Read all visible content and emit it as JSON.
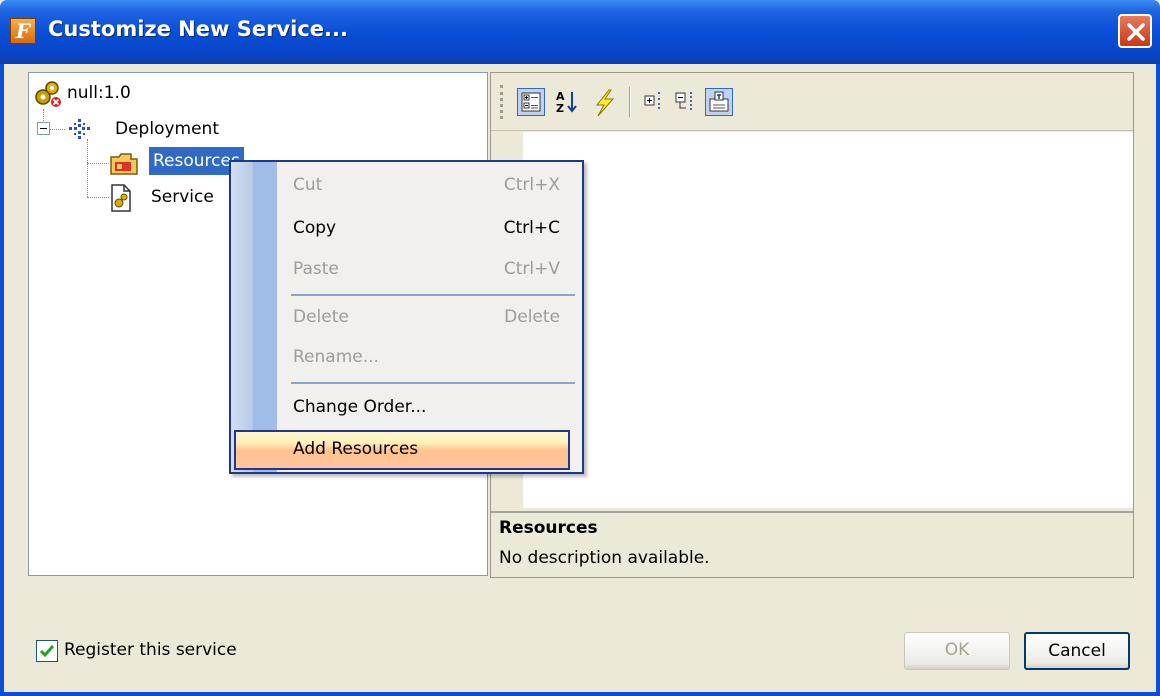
{
  "window": {
    "title": "Customize New Service...",
    "app_icon_letter": "F",
    "icons": {
      "app": "app-logo-icon",
      "close": "close-icon"
    }
  },
  "tree": {
    "root": {
      "label": "null:1.0",
      "icon": "service-gears-error-icon"
    },
    "nodes": [
      {
        "label": "Deployment",
        "icon": "deployment-icon",
        "expanded": true
      },
      {
        "label": "Resources",
        "icon": "folder-icon",
        "selected": true
      },
      {
        "label": "Service ",
        "icon": "service-document-icon"
      }
    ]
  },
  "toolbar": {
    "buttons": [
      {
        "name": "categorized-view",
        "icon": "categorized-icon",
        "pressed": true
      },
      {
        "name": "sort-alphabetical",
        "icon": "sort-az-icon",
        "pressed": false
      },
      {
        "name": "events",
        "icon": "lightning-icon",
        "pressed": false
      },
      {
        "name": "expand-all",
        "icon": "expand-all-icon",
        "pressed": false
      },
      {
        "name": "collapse-all",
        "icon": "collapse-all-icon",
        "pressed": false
      },
      {
        "name": "show-description",
        "icon": "description-icon",
        "pressed": true
      }
    ]
  },
  "description": {
    "title": "Resources",
    "text": "No description available."
  },
  "context_menu": {
    "items": [
      {
        "label": "Cut",
        "shortcut": "Ctrl+X",
        "enabled": false
      },
      {
        "label": "Copy",
        "shortcut": "Ctrl+C",
        "enabled": true
      },
      {
        "label": "Paste",
        "shortcut": "Ctrl+V",
        "enabled": false
      },
      {
        "label": "Delete",
        "shortcut": "Delete",
        "enabled": false
      },
      {
        "label": "Rename...",
        "shortcut": "",
        "enabled": false
      },
      {
        "label": "Change Order...",
        "shortcut": "",
        "enabled": true
      },
      {
        "label": "Add Resources",
        "shortcut": "",
        "enabled": true,
        "highlighted": true
      }
    ]
  },
  "footer": {
    "register_label": "Register this service",
    "register_checked": true,
    "ok_label": "OK",
    "ok_enabled": false,
    "cancel_label": "Cancel"
  },
  "colors": {
    "titlebar": "#0a4fd8",
    "selection": "#316ac5",
    "menu_highlight": "#ffc28f",
    "checkmark": "#21a121"
  }
}
